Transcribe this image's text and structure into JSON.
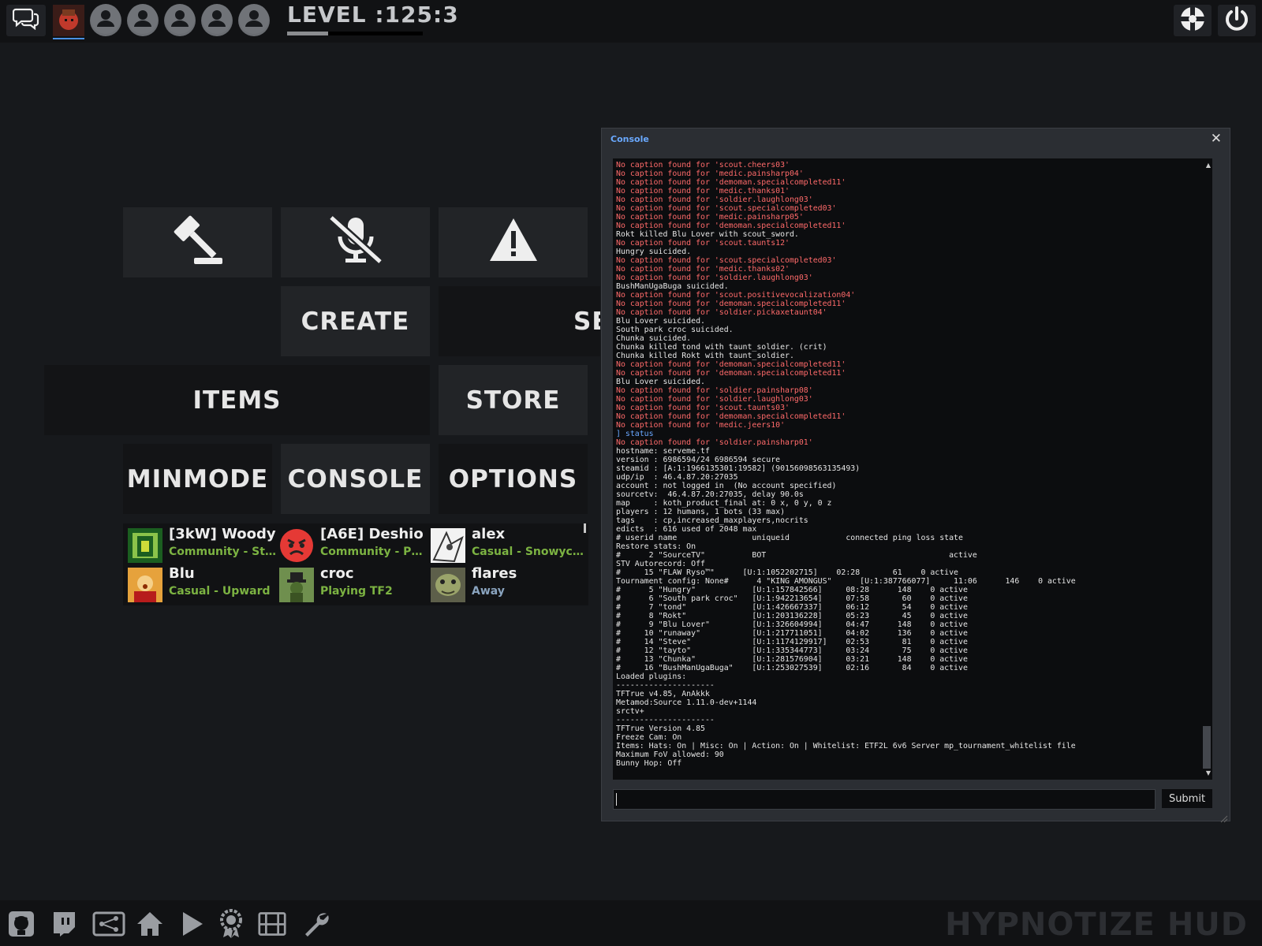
{
  "topbar": {
    "level_text": "LEVEL :125:3",
    "level_progress": 0.3,
    "icons": [
      "chat-icon",
      "player-avatar",
      "party-slot-icon",
      "party-slot-icon",
      "party-slot-icon",
      "party-slot-icon",
      "party-slot-icon",
      "tf2-logo-icon",
      "power-icon"
    ]
  },
  "menu": {
    "create": "CREATE",
    "servers_partial": "SE",
    "items": "ITEMS",
    "store": "STORE",
    "minmode": "MINMODE",
    "console": "CONSOLE",
    "options": "OPTIONS"
  },
  "friends": [
    {
      "name": "[3kW] Woody",
      "status": "Community - Steel ...",
      "status_color": "#7cb342"
    },
    {
      "name": "[A6E] Deshio",
      "status": "Community - Proce...",
      "status_color": "#7cb342"
    },
    {
      "name": "alex",
      "status": "Casual - Snowycoast",
      "status_color": "#7cb342"
    },
    {
      "name": "Blu",
      "status": "Casual - Upward",
      "status_color": "#7cb342"
    },
    {
      "name": "croc",
      "status": "Playing TF2",
      "status_color": "#7cb342"
    },
    {
      "name": "flares",
      "status": "Away",
      "status_color": "#8aa4bf"
    }
  ],
  "console": {
    "title": "Console",
    "close": "✕",
    "submit": "Submit",
    "lines": [
      {
        "c": "r",
        "t": "No caption found for 'scout.cheers03'"
      },
      {
        "c": "r",
        "t": "No caption found for 'medic.painsharp04'"
      },
      {
        "c": "r",
        "t": "No caption found for 'demoman.specialcompleted11'"
      },
      {
        "c": "r",
        "t": "No caption found for 'medic.thanks01'"
      },
      {
        "c": "r",
        "t": "No caption found for 'soldier.laughlong03'"
      },
      {
        "c": "r",
        "t": "No caption found for 'scout.specialcompleted03'"
      },
      {
        "c": "r",
        "t": "No caption found for 'medic.painsharp05'"
      },
      {
        "c": "r",
        "t": "No caption found for 'demoman.specialcompleted11'"
      },
      {
        "c": "w",
        "t": "Rokt killed Blu Lover with scout_sword."
      },
      {
        "c": "r",
        "t": "No caption found for 'scout.taunts12'"
      },
      {
        "c": "w",
        "t": "Hungry suicided."
      },
      {
        "c": "r",
        "t": "No caption found for 'scout.specialcompleted03'"
      },
      {
        "c": "r",
        "t": "No caption found for 'medic.thanks02'"
      },
      {
        "c": "r",
        "t": "No caption found for 'soldier.laughlong03'"
      },
      {
        "c": "w",
        "t": "BushManUgaBuga suicided."
      },
      {
        "c": "r",
        "t": "No caption found for 'scout.positivevocalization04'"
      },
      {
        "c": "r",
        "t": "No caption found for 'demoman.specialcompleted11'"
      },
      {
        "c": "r",
        "t": "No caption found for 'soldier.pickaxetaunt04'"
      },
      {
        "c": "w",
        "t": "Blu Lover suicided."
      },
      {
        "c": "w",
        "t": "South park croc suicided."
      },
      {
        "c": "w",
        "t": "Chunka suicided."
      },
      {
        "c": "w",
        "t": "Chunka killed tond with taunt_soldier. (crit)"
      },
      {
        "c": "w",
        "t": "Chunka killed Rokt with taunt_soldier."
      },
      {
        "c": "r",
        "t": "No caption found for 'demoman.specialcompleted11'"
      },
      {
        "c": "r",
        "t": "No caption found for 'demoman.specialcompleted11'"
      },
      {
        "c": "w",
        "t": "Blu Lover suicided."
      },
      {
        "c": "r",
        "t": "No caption found for 'soldier.painsharp08'"
      },
      {
        "c": "r",
        "t": "No caption found for 'soldier.laughlong03'"
      },
      {
        "c": "r",
        "t": "No caption found for 'scout.taunts03'"
      },
      {
        "c": "r",
        "t": "No caption found for 'demoman.specialcompleted11'"
      },
      {
        "c": "r",
        "t": "No caption found for 'medic.jeers10'"
      },
      {
        "c": "b",
        "t": "] status"
      },
      {
        "c": "r",
        "t": "No caption found for 'soldier.painsharp01'"
      },
      {
        "c": "w",
        "t": "hostname: serveme.tf"
      },
      {
        "c": "w",
        "t": "version : 6986594/24 6986594 secure"
      },
      {
        "c": "w",
        "t": "steamid : [A:1:1966135301:19582] (90156098563135493)"
      },
      {
        "c": "w",
        "t": "udp/ip  : 46.4.87.20:27035"
      },
      {
        "c": "w",
        "t": "account : not logged in  (No account specified)"
      },
      {
        "c": "w",
        "t": "sourcetv:  46.4.87.20:27035, delay 90.0s"
      },
      {
        "c": "w",
        "t": "map     : koth_product_final at: 0 x, 0 y, 0 z"
      },
      {
        "c": "w",
        "t": "players : 12 humans, 1 bots (33 max)"
      },
      {
        "c": "w",
        "t": "tags    : cp,increased_maxplayers,nocrits"
      },
      {
        "c": "w",
        "t": "edicts  : 616 used of 2048 max"
      },
      {
        "c": "w",
        "t": "# userid name                uniqueid            connected ping loss state"
      },
      {
        "c": "w",
        "t": "Restore stats: On"
      },
      {
        "c": "w",
        "t": "#      2 \"SourceTV\"          BOT                                       active"
      },
      {
        "c": "w",
        "t": "STV Autorecord: Off"
      },
      {
        "c": "w",
        "t": "#     15 \"FLAW Ryso™\"      [U:1:1052202715]    02:28       61    0 active"
      },
      {
        "c": "w",
        "t": "Tournament config: None#      4 \"KING AMONGUS\"      [U:1:387766077]     11:06      146    0 active"
      },
      {
        "c": "w",
        "t": "#      5 \"Hungry\"            [U:1:157842566]     08:28      148    0 active"
      },
      {
        "c": "w",
        "t": "#      6 \"South park croc\"   [U:1:942213654]     07:58       60    0 active"
      },
      {
        "c": "w",
        "t": "#      7 \"tond\"              [U:1:426667337]     06:12       54    0 active"
      },
      {
        "c": "w",
        "t": "#      8 \"Rokt\"              [U:1:203136228]     05:23       45    0 active"
      },
      {
        "c": "w",
        "t": "#      9 \"Blu Lover\"         [U:1:326604994]     04:47      148    0 active"
      },
      {
        "c": "w",
        "t": "#     10 \"runaway\"           [U:1:217711051]     04:02      136    0 active"
      },
      {
        "c": "w",
        "t": "#     14 \"Steve\"             [U:1:1174129917]    02:53       81    0 active"
      },
      {
        "c": "w",
        "t": "#     12 \"tayto\"             [U:1:335344773]     03:24       75    0 active"
      },
      {
        "c": "w",
        "t": "#     13 \"Chunka\"            [U:1:281576904]     03:21      148    0 active"
      },
      {
        "c": "w",
        "t": "#     16 \"BushManUgaBuga\"    [U:1:253027539]     02:16       84    0 active"
      },
      {
        "c": "w",
        "t": "Loaded plugins:"
      },
      {
        "c": "w",
        "t": "---------------------"
      },
      {
        "c": "w",
        "t": "TFTrue v4.85, AnAkkk"
      },
      {
        "c": "w",
        "t": "Metamod:Source 1.11.0-dev+1144"
      },
      {
        "c": "w",
        "t": "srctv+"
      },
      {
        "c": "w",
        "t": "---------------------"
      },
      {
        "c": "w",
        "t": "TFTrue Version 4.85"
      },
      {
        "c": "w",
        "t": "Freeze Cam: On"
      },
      {
        "c": "w",
        "t": "Items: Hats: On | Misc: On | Action: On | Whitelist: ETF2L 6v6 Server mp_tournament_whitelist file"
      },
      {
        "c": "w",
        "t": "Maximum FoV allowed: 90"
      },
      {
        "c": "w",
        "t": "Bunny Hop: Off"
      }
    ]
  },
  "bottombar": {
    "brand": "HYPNOTIZE HUD",
    "icons": [
      "github-icon",
      "twitch-icon",
      "servers-icon",
      "home-icon",
      "play-icon",
      "achievement-icon",
      "replay-icon",
      "wrench-icon"
    ]
  }
}
